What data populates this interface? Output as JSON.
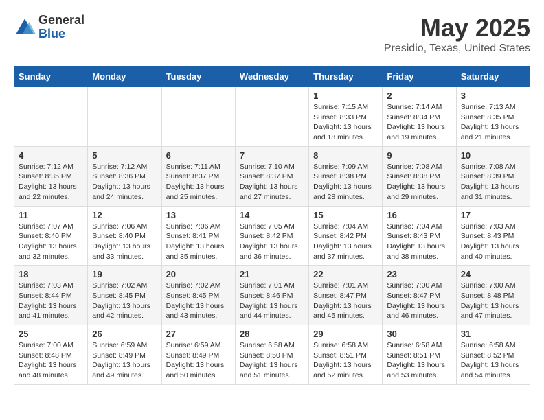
{
  "header": {
    "logo": {
      "general": "General",
      "blue": "Blue"
    },
    "title": "May 2025",
    "subtitle": "Presidio, Texas, United States"
  },
  "weekdays": [
    "Sunday",
    "Monday",
    "Tuesday",
    "Wednesday",
    "Thursday",
    "Friday",
    "Saturday"
  ],
  "weeks": [
    [
      {
        "day": "",
        "sunrise": "",
        "sunset": "",
        "daylight": ""
      },
      {
        "day": "",
        "sunrise": "",
        "sunset": "",
        "daylight": ""
      },
      {
        "day": "",
        "sunrise": "",
        "sunset": "",
        "daylight": ""
      },
      {
        "day": "",
        "sunrise": "",
        "sunset": "",
        "daylight": ""
      },
      {
        "day": "1",
        "sunrise": "Sunrise: 7:15 AM",
        "sunset": "Sunset: 8:33 PM",
        "daylight": "Daylight: 13 hours and 18 minutes."
      },
      {
        "day": "2",
        "sunrise": "Sunrise: 7:14 AM",
        "sunset": "Sunset: 8:34 PM",
        "daylight": "Daylight: 13 hours and 19 minutes."
      },
      {
        "day": "3",
        "sunrise": "Sunrise: 7:13 AM",
        "sunset": "Sunset: 8:35 PM",
        "daylight": "Daylight: 13 hours and 21 minutes."
      }
    ],
    [
      {
        "day": "4",
        "sunrise": "Sunrise: 7:12 AM",
        "sunset": "Sunset: 8:35 PM",
        "daylight": "Daylight: 13 hours and 22 minutes."
      },
      {
        "day": "5",
        "sunrise": "Sunrise: 7:12 AM",
        "sunset": "Sunset: 8:36 PM",
        "daylight": "Daylight: 13 hours and 24 minutes."
      },
      {
        "day": "6",
        "sunrise": "Sunrise: 7:11 AM",
        "sunset": "Sunset: 8:37 PM",
        "daylight": "Daylight: 13 hours and 25 minutes."
      },
      {
        "day": "7",
        "sunrise": "Sunrise: 7:10 AM",
        "sunset": "Sunset: 8:37 PM",
        "daylight": "Daylight: 13 hours and 27 minutes."
      },
      {
        "day": "8",
        "sunrise": "Sunrise: 7:09 AM",
        "sunset": "Sunset: 8:38 PM",
        "daylight": "Daylight: 13 hours and 28 minutes."
      },
      {
        "day": "9",
        "sunrise": "Sunrise: 7:08 AM",
        "sunset": "Sunset: 8:38 PM",
        "daylight": "Daylight: 13 hours and 29 minutes."
      },
      {
        "day": "10",
        "sunrise": "Sunrise: 7:08 AM",
        "sunset": "Sunset: 8:39 PM",
        "daylight": "Daylight: 13 hours and 31 minutes."
      }
    ],
    [
      {
        "day": "11",
        "sunrise": "Sunrise: 7:07 AM",
        "sunset": "Sunset: 8:40 PM",
        "daylight": "Daylight: 13 hours and 32 minutes."
      },
      {
        "day": "12",
        "sunrise": "Sunrise: 7:06 AM",
        "sunset": "Sunset: 8:40 PM",
        "daylight": "Daylight: 13 hours and 33 minutes."
      },
      {
        "day": "13",
        "sunrise": "Sunrise: 7:06 AM",
        "sunset": "Sunset: 8:41 PM",
        "daylight": "Daylight: 13 hours and 35 minutes."
      },
      {
        "day": "14",
        "sunrise": "Sunrise: 7:05 AM",
        "sunset": "Sunset: 8:42 PM",
        "daylight": "Daylight: 13 hours and 36 minutes."
      },
      {
        "day": "15",
        "sunrise": "Sunrise: 7:04 AM",
        "sunset": "Sunset: 8:42 PM",
        "daylight": "Daylight: 13 hours and 37 minutes."
      },
      {
        "day": "16",
        "sunrise": "Sunrise: 7:04 AM",
        "sunset": "Sunset: 8:43 PM",
        "daylight": "Daylight: 13 hours and 38 minutes."
      },
      {
        "day": "17",
        "sunrise": "Sunrise: 7:03 AM",
        "sunset": "Sunset: 8:43 PM",
        "daylight": "Daylight: 13 hours and 40 minutes."
      }
    ],
    [
      {
        "day": "18",
        "sunrise": "Sunrise: 7:03 AM",
        "sunset": "Sunset: 8:44 PM",
        "daylight": "Daylight: 13 hours and 41 minutes."
      },
      {
        "day": "19",
        "sunrise": "Sunrise: 7:02 AM",
        "sunset": "Sunset: 8:45 PM",
        "daylight": "Daylight: 13 hours and 42 minutes."
      },
      {
        "day": "20",
        "sunrise": "Sunrise: 7:02 AM",
        "sunset": "Sunset: 8:45 PM",
        "daylight": "Daylight: 13 hours and 43 minutes."
      },
      {
        "day": "21",
        "sunrise": "Sunrise: 7:01 AM",
        "sunset": "Sunset: 8:46 PM",
        "daylight": "Daylight: 13 hours and 44 minutes."
      },
      {
        "day": "22",
        "sunrise": "Sunrise: 7:01 AM",
        "sunset": "Sunset: 8:47 PM",
        "daylight": "Daylight: 13 hours and 45 minutes."
      },
      {
        "day": "23",
        "sunrise": "Sunrise: 7:00 AM",
        "sunset": "Sunset: 8:47 PM",
        "daylight": "Daylight: 13 hours and 46 minutes."
      },
      {
        "day": "24",
        "sunrise": "Sunrise: 7:00 AM",
        "sunset": "Sunset: 8:48 PM",
        "daylight": "Daylight: 13 hours and 47 minutes."
      }
    ],
    [
      {
        "day": "25",
        "sunrise": "Sunrise: 7:00 AM",
        "sunset": "Sunset: 8:48 PM",
        "daylight": "Daylight: 13 hours and 48 minutes."
      },
      {
        "day": "26",
        "sunrise": "Sunrise: 6:59 AM",
        "sunset": "Sunset: 8:49 PM",
        "daylight": "Daylight: 13 hours and 49 minutes."
      },
      {
        "day": "27",
        "sunrise": "Sunrise: 6:59 AM",
        "sunset": "Sunset: 8:49 PM",
        "daylight": "Daylight: 13 hours and 50 minutes."
      },
      {
        "day": "28",
        "sunrise": "Sunrise: 6:58 AM",
        "sunset": "Sunset: 8:50 PM",
        "daylight": "Daylight: 13 hours and 51 minutes."
      },
      {
        "day": "29",
        "sunrise": "Sunrise: 6:58 AM",
        "sunset": "Sunset: 8:51 PM",
        "daylight": "Daylight: 13 hours and 52 minutes."
      },
      {
        "day": "30",
        "sunrise": "Sunrise: 6:58 AM",
        "sunset": "Sunset: 8:51 PM",
        "daylight": "Daylight: 13 hours and 53 minutes."
      },
      {
        "day": "31",
        "sunrise": "Sunrise: 6:58 AM",
        "sunset": "Sunset: 8:52 PM",
        "daylight": "Daylight: 13 hours and 54 minutes."
      }
    ]
  ]
}
